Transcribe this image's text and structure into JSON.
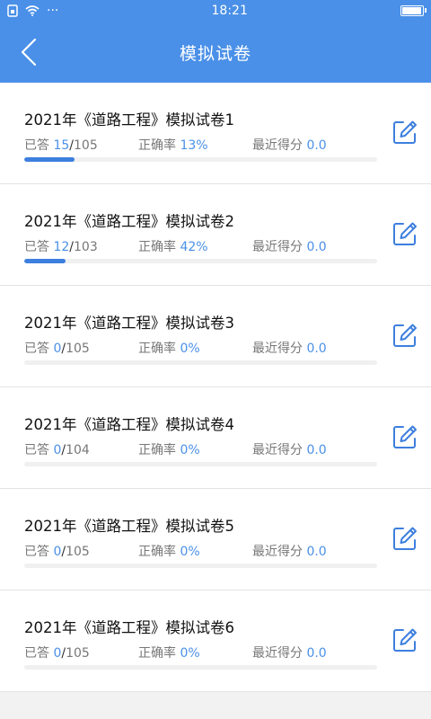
{
  "status": {
    "time": "18:21",
    "dots": "···"
  },
  "nav": {
    "title": "模拟试卷"
  },
  "labels": {
    "answered": "已答",
    "accuracy": "正确率",
    "recent": "最近得分",
    "slash": "/"
  },
  "colors": {
    "primary": "#4a90e8",
    "progress": "#3d7fde"
  },
  "icons": {
    "back": "back-arrow-icon",
    "edit": "edit-icon"
  },
  "papers": [
    {
      "title": "2021年《道路工程》模拟试卷1",
      "answered": "15",
      "total": "105",
      "accuracy": "13%",
      "score": "0.0",
      "progress": 0.143
    },
    {
      "title": "2021年《道路工程》模拟试卷2",
      "answered": "12",
      "total": "103",
      "accuracy": "42%",
      "score": "0.0",
      "progress": 0.117
    },
    {
      "title": "2021年《道路工程》模拟试卷3",
      "answered": "0",
      "total": "105",
      "accuracy": "0%",
      "score": "0.0",
      "progress": 0
    },
    {
      "title": "2021年《道路工程》模拟试卷4",
      "answered": "0",
      "total": "104",
      "accuracy": "0%",
      "score": "0.0",
      "progress": 0
    },
    {
      "title": "2021年《道路工程》模拟试卷5",
      "answered": "0",
      "total": "105",
      "accuracy": "0%",
      "score": "0.0",
      "progress": 0
    },
    {
      "title": "2021年《道路工程》模拟试卷6",
      "answered": "0",
      "total": "105",
      "accuracy": "0%",
      "score": "0.0",
      "progress": 0
    }
  ]
}
